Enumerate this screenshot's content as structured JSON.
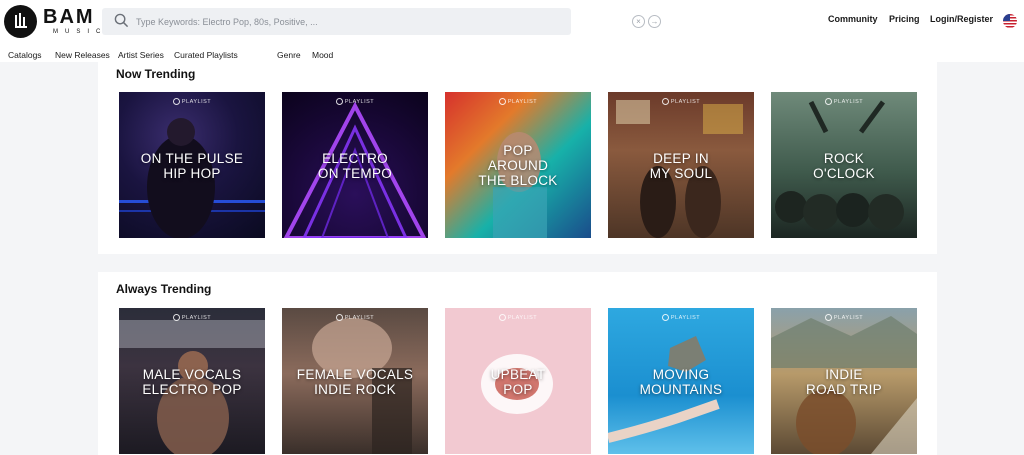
{
  "header": {
    "logo_main": "BAM",
    "logo_sub": "MUSIC",
    "search": {
      "placeholder": "Type Keywords: Electro Pop, 80s, Positive, ..."
    },
    "nav_right": [
      "Community",
      "Pricing",
      "Login/Register"
    ]
  },
  "subnav": [
    "Catalogs",
    "New Releases",
    "Artist Series",
    "Curated Playlists",
    "Genre",
    "Mood"
  ],
  "sections": [
    {
      "title": "Now Trending",
      "cards": [
        {
          "badge": "PLAYLIST",
          "title": "ON THE PULSE\nHIP HOP"
        },
        {
          "badge": "PLAYLIST",
          "title": "ELECTRO\nON TEMPO"
        },
        {
          "badge": "PLAYLIST",
          "title": "POP\nAROUND\nTHE BLOCK"
        },
        {
          "badge": "PLAYLIST",
          "title": "DEEP IN\nMY SOUL"
        },
        {
          "badge": "PLAYLIST",
          "title": "ROCK\nO'CLOCK"
        }
      ]
    },
    {
      "title": "Always Trending",
      "cards": [
        {
          "badge": "PLAYLIST",
          "title": "MALE VOCALS\nELECTRO POP"
        },
        {
          "badge": "PLAYLIST",
          "title": "FEMALE VOCALS\nINDIE ROCK"
        },
        {
          "badge": "PLAYLIST",
          "title": "UPBEAT\nPOP"
        },
        {
          "badge": "PLAYLIST",
          "title": "MOVING\nMOUNTAINS"
        },
        {
          "badge": "PLAYLIST",
          "title": "INDIE\nROAD TRIP"
        }
      ]
    }
  ]
}
